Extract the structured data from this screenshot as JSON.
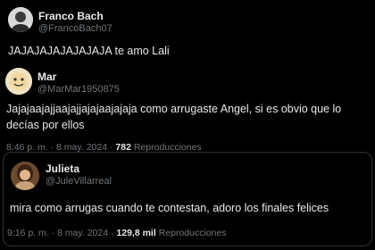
{
  "posts": [
    {
      "name": "Franco Bach",
      "handle": "@FrancoBach07",
      "text": "JAJAJAJAJAJAJAJA te amo Lali"
    },
    {
      "name": "Mar",
      "handle": "@MarMar1950875",
      "text": "Jajajaajajjaajajjajajaajajaja como arrugaste Angel, si es obvio que lo decías por ellos",
      "time": "8:46 p. m.",
      "date": "8 may. 2024",
      "views": "782",
      "views_label": "Reproducciones"
    },
    {
      "name": "Julieta",
      "handle": "@JuleVillarreal",
      "text": "mira como arrugas cuando te contestan, adoro los finales felices",
      "time": "9:16 p. m.",
      "date": "8 may. 2024",
      "views": "129,8 mil",
      "views_label": "Reproducciones"
    }
  ],
  "separator": "·",
  "colors": {
    "background": "#000000",
    "text": "#e7e9ea",
    "secondary": "#71767b",
    "border": "#2f3336"
  }
}
